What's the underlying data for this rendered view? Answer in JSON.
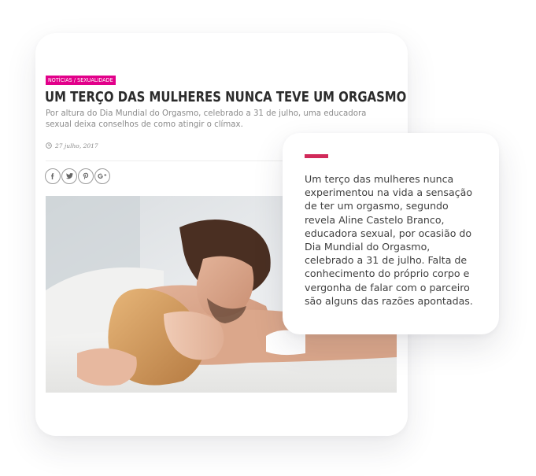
{
  "article": {
    "category": "NOTÍCIAS / SEXUALIDADE",
    "title": "UM TERÇO DAS MULHERES NUNCA TEVE UM ORGASMO",
    "excerpt": "Por altura do Dia Mundial do Orgasmo, celebrado a 31 de julho, uma educadora sexual deixa conselhos de como atingir o clímax.",
    "date": "27 julho, 2017",
    "share_icons": [
      "facebook-icon",
      "twitter-icon",
      "pinterest-icon",
      "google-plus-icon"
    ]
  },
  "quote": {
    "text": "Um terço das mulheres nunca experimentou na vida a sensação de ter um orgasmo, segundo revela Aline Castelo Branco, educadora sexual, por ocasião do Dia Mundial do Orgasmo, celebrado a 31 de julho. Falta de conhecimento do próprio corpo e vergonha de falar com o parceiro são alguns das razões apontadas."
  },
  "colors": {
    "category_badge": "#e2008a",
    "accent_bar": "#d12a5a",
    "headline": "#2b2b2b",
    "muted_text": "#8b8b8b"
  }
}
